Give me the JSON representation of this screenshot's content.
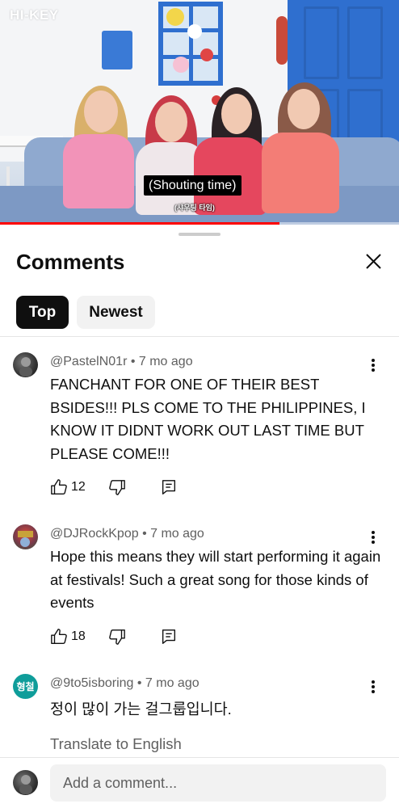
{
  "video": {
    "logo": "HI-KEY",
    "caption_main": "(Shouting time)",
    "caption_sub": "(샤우팅 타임)",
    "progress_fraction": 0.7
  },
  "sheet": {
    "title": "Comments",
    "close_icon": "close-icon",
    "chips": [
      {
        "label": "Top",
        "selected": true
      },
      {
        "label": "Newest",
        "selected": false
      }
    ]
  },
  "comments": [
    {
      "author_line": "@PastelN01r • 7 mo ago",
      "text": "FANCHANT FOR ONE OF THEIR BEST BSIDES!!! PLS COME TO THE PHILIPPINES, I KNOW IT DIDNT WORK OUT LAST TIME BUT PLEASE COME!!!",
      "likes": "12",
      "avatar": "dark-photo"
    },
    {
      "author_line": "@DJRockKpop • 7 mo ago",
      "text": "Hope this means they will start performing it again at festivals! Such a great song for those kinds of events",
      "likes": "18",
      "avatar": "colorful-photo"
    },
    {
      "author_line": "@9to5isboring • 7 mo ago",
      "text": "정이 많이 가는 걸그룹입니다.",
      "avatar_text": "형철",
      "avatar_color": "#0f9d9a",
      "translate_label": "Translate to English"
    }
  ],
  "add_comment": {
    "placeholder": "Add a comment..."
  },
  "colors": {
    "accent_red": "#ff0000",
    "chip_selected_bg": "#0f0f0f",
    "chip_bg": "#f2f2f2",
    "secondary_text": "#606060"
  }
}
